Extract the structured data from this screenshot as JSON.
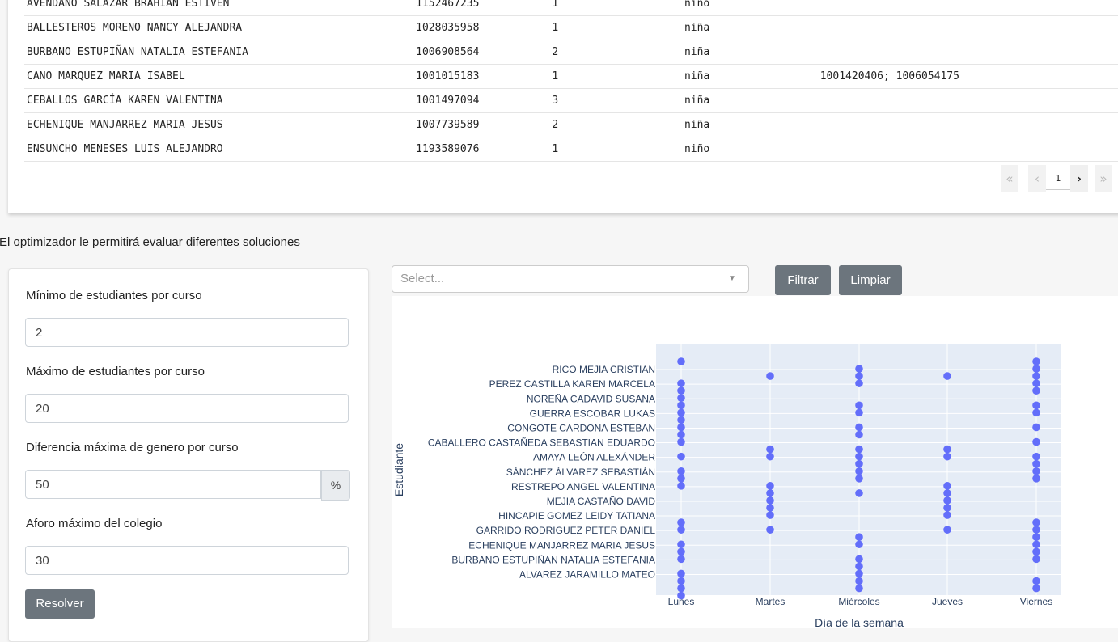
{
  "students_table": {
    "rows": [
      [
        "AVENDAÑO SALAZAR BRAHIAN ESTIVEN",
        "1152467235",
        "1",
        "niño",
        ""
      ],
      [
        "BALLESTEROS MORENO NANCY ALEJANDRA",
        "1028035958",
        "1",
        "niña",
        ""
      ],
      [
        "BURBANO ESTUPIÑAN NATALIA ESTEFANIA",
        "1006908564",
        "2",
        "niña",
        ""
      ],
      [
        "CANO MARQUEZ MARIA ISABEL",
        "1001015183",
        "1",
        "niña",
        "1001420406; 1006054175"
      ],
      [
        "CEBALLOS GARCÍA KAREN VALENTINA",
        "1001497094",
        "3",
        "niña",
        ""
      ],
      [
        "ECHENIQUE MANJARREZ MARIA JESUS",
        "1007739589",
        "2",
        "niña",
        ""
      ],
      [
        "ENSUNCHO MENESES LUIS ALEJANDRO",
        "1193589076",
        "1",
        "niño",
        ""
      ]
    ]
  },
  "pagination": {
    "first": "«",
    "prev": "‹",
    "page": "1",
    "next": "›",
    "last": "»"
  },
  "intro_text": "El optimizador le permitirá evaluar diferentes soluciones",
  "form": {
    "min_label": "Mínimo de estudiantes por curso",
    "min_value": "2",
    "max_label": "Máximo de estudiantes por curso",
    "max_value": "20",
    "gender_label": "Diferencia máxima de genero por curso",
    "gender_value": "50",
    "gender_unit": "%",
    "capacity_label": "Aforo máximo del colegio",
    "capacity_value": "30",
    "solve_button": "Resolver"
  },
  "filter": {
    "placeholder": "Select...",
    "filter_button": "Filtrar",
    "clear_button": "Limpiar"
  },
  "chart_data": {
    "type": "scatter",
    "xlabel": "Día de la semana",
    "ylabel": "Estudiante",
    "categories_x": [
      "Lunes",
      "Martes",
      "Miércoles",
      "Jueves",
      "Viernes"
    ],
    "y_tick_labels": [
      "RICO MEJIA CRISTIAN",
      "PEREZ CASTILLA KAREN MARCELA",
      "NOREÑA CADAVID SUSANA",
      "GUERRA ESCOBAR LUKAS",
      "CONGOTE CARDONA ESTEBAN",
      "CABALLERO CASTAÑEDA SEBASTIAN EDUARDO",
      "AMAYA LEÓN ALEXÁNDER",
      "SÁNCHEZ ÁLVAREZ SEBASTIÁN",
      "RESTREPO ANGEL VALENTINA",
      "MEJIA CASTAÑO DAVID",
      "HINCAPIE GOMEZ LEIDY TATIANA",
      "GARRIDO RODRIGUEZ PETER DANIEL",
      "ECHENIQUE MANJARREZ MARIA JESUS",
      "BURBANO ESTUPIÑAN NATALIA ESTEFANIA",
      "ALVAREZ JARAMILLO MATEO"
    ],
    "n_rows": 30,
    "points": [
      {
        "day": "Lunes",
        "rows": [
          1,
          4,
          5,
          6,
          7,
          8,
          9,
          10,
          11,
          12,
          14,
          16,
          17,
          18,
          23,
          24,
          26,
          27,
          28,
          30,
          31,
          32,
          33
        ]
      },
      {
        "day": "Martes",
        "rows": [
          3,
          13,
          14,
          18,
          19,
          20,
          21,
          22,
          24
        ]
      },
      {
        "day": "Miércoles",
        "rows": [
          2,
          3,
          4,
          7,
          8,
          10,
          11,
          13,
          14,
          15,
          16,
          17,
          19,
          25,
          26,
          28,
          29,
          30,
          31,
          32
        ]
      },
      {
        "day": "Jueves",
        "rows": [
          3,
          13,
          14,
          18,
          19,
          20,
          21,
          22,
          24
        ]
      },
      {
        "day": "Viernes",
        "rows": [
          1,
          2,
          3,
          4,
          5,
          7,
          8,
          10,
          12,
          14,
          15,
          16,
          17,
          23,
          24,
          25,
          26,
          27,
          28,
          31,
          32
        ]
      }
    ],
    "grid": true,
    "colors": {
      "marker": "#636efa",
      "plot_bg": "#e5ecf6"
    }
  }
}
